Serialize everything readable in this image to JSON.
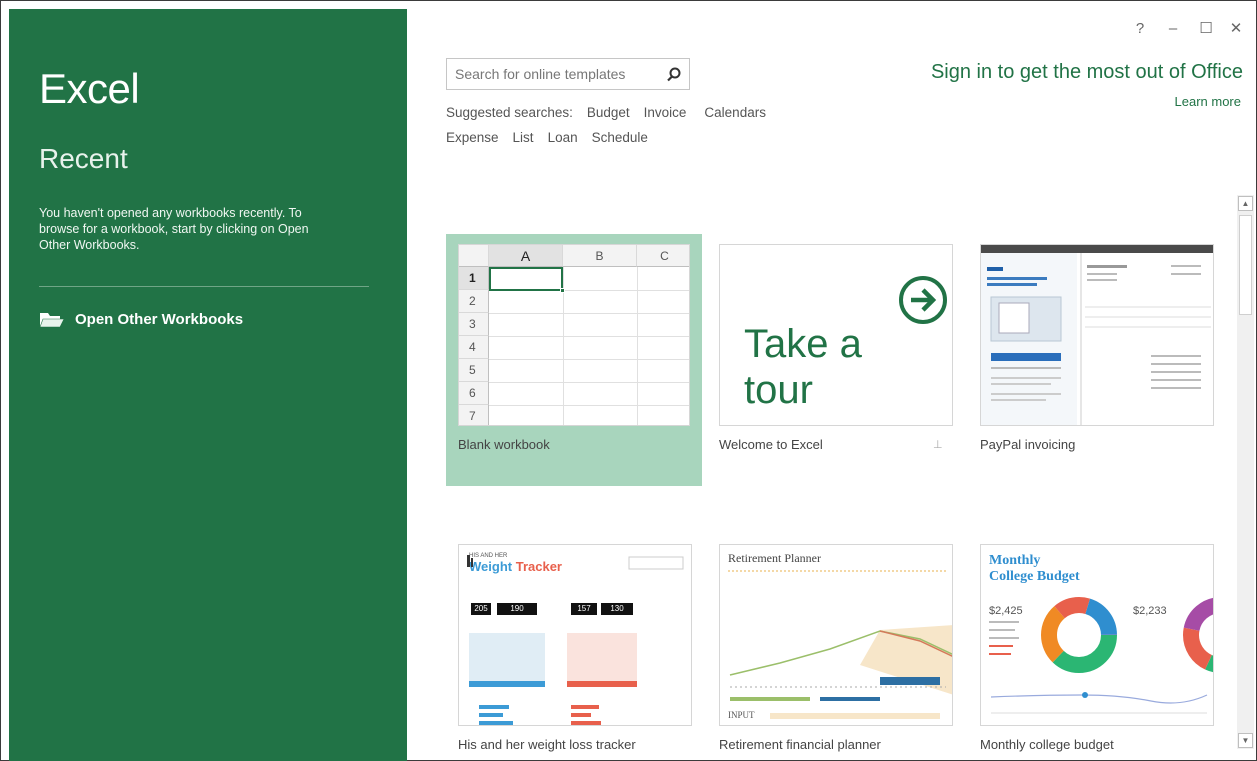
{
  "app": {
    "title": "Excel"
  },
  "sidebar": {
    "recent_heading": "Recent",
    "empty_message": "You haven't opened any workbooks recently. To browse for a workbook, start by clicking on Open Other Workbooks.",
    "open_other_label": "Open Other Workbooks"
  },
  "window_controls": {
    "help": "?",
    "minimize": "–",
    "maximize": "☐",
    "close": "✕"
  },
  "search": {
    "placeholder": "Search for online templates",
    "value": "",
    "suggested_label": "Suggested searches:",
    "suggestions_row1": [
      "Budget",
      "Invoice",
      "Calendars"
    ],
    "suggestions_row2": [
      "Expense",
      "List",
      "Loan",
      "Schedule"
    ]
  },
  "account": {
    "sign_in_text": "Sign in to get the most out of Office",
    "learn_more": "Learn more"
  },
  "templates": [
    {
      "caption": "Blank workbook",
      "selected": true
    },
    {
      "caption": "Welcome to Excel",
      "thumb_text_1": "Take a",
      "thumb_text_2": "tour"
    },
    {
      "caption": "PayPal invoicing"
    },
    {
      "caption": "His and her weight loss tracker",
      "thumb_small": "HIS AND HER",
      "thumb_title_a": "Weight",
      "thumb_title_b": "Tracker",
      "values": [
        "205",
        "190",
        "157",
        "130"
      ]
    },
    {
      "caption": "Retirement financial planner",
      "thumb_title": "Retirement Planner",
      "thumb_footer": "INPUT"
    },
    {
      "caption": "Monthly college budget",
      "thumb_title_1": "Monthly",
      "thumb_title_2": "College Budget",
      "amount_1": "$2,425",
      "amount_2": "$2,233"
    }
  ],
  "grid": {
    "columns": [
      "A",
      "B",
      "C"
    ],
    "rows": [
      "1",
      "2",
      "3",
      "4",
      "5",
      "6",
      "7"
    ]
  },
  "colors": {
    "accent": "#217346",
    "selected_tile": "#a8d5bd"
  }
}
